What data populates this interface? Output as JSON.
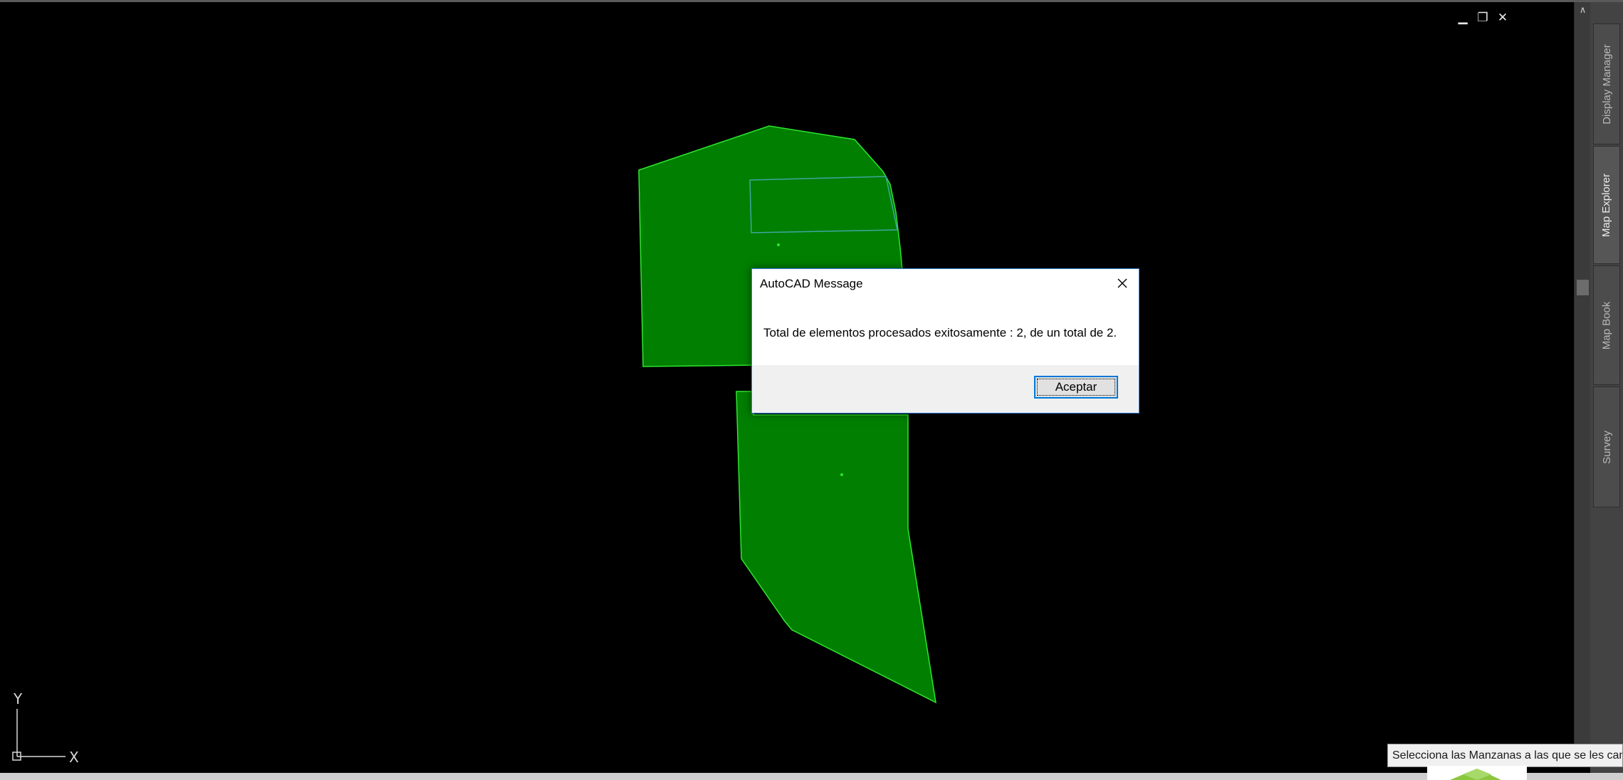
{
  "window": {
    "controls": {
      "minimize": "▁",
      "restore": "❐",
      "close": "✕"
    }
  },
  "side_tabs": [
    {
      "label": "Display Manager",
      "active": false
    },
    {
      "label": "Map Explorer",
      "active": true
    },
    {
      "label": "Map Book",
      "active": false
    },
    {
      "label": "Survey",
      "active": false
    }
  ],
  "ucs": {
    "y_label": "Y",
    "x_label": "X"
  },
  "dialog": {
    "title": "AutoCAD Message",
    "message": "Total de elementos procesados exitosamente : 2, de un total de 2.",
    "ok_label": "Aceptar"
  },
  "status": {
    "prompt": "Selecciona las Manzanas a las que se les cant"
  },
  "colors": {
    "polygon_fill": "#007f00",
    "polygon_edge": "#2ee62e",
    "inner_rect_edge": "#3fa6a0",
    "dialog_border": "#2d7bd6",
    "background": "#000000"
  }
}
